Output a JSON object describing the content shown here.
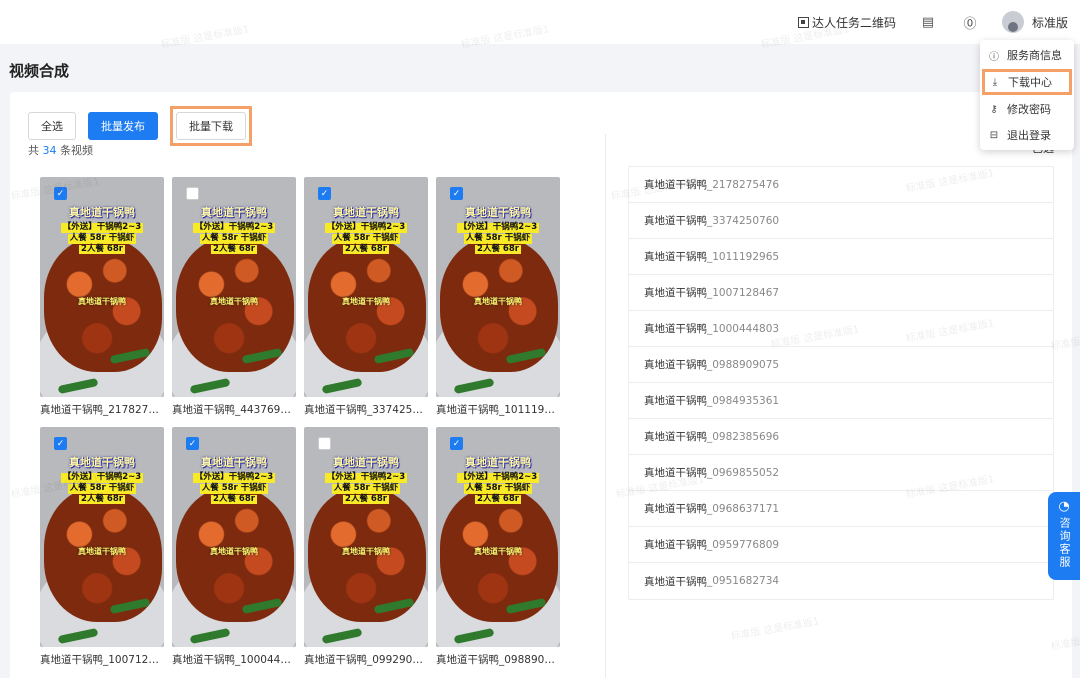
{
  "topbar": {
    "qr_label": "达人任务二维码",
    "message_icon": "message-icon",
    "help_icon": "question-circle-icon",
    "user_label": "标准版"
  },
  "page": {
    "title": "视频合成"
  },
  "toolbar": {
    "select_all": "全选",
    "batch_publish": "批量发布",
    "batch_download": "批量下载"
  },
  "summary": {
    "prefix": "共",
    "count": "34",
    "suffix": "条视频"
  },
  "videos": [
    {
      "name": "真地道干锅鸭_2178275...",
      "checked": true
    },
    {
      "name": "真地道干锅鸭_4437696...",
      "checked": false
    },
    {
      "name": "真地道干锅鸭_3374250...",
      "checked": true
    },
    {
      "name": "真地道干锅鸭_1011192...",
      "checked": true
    },
    {
      "name": "真地道干锅鸭_1007128...",
      "checked": true
    },
    {
      "name": "真地道干锅鸭_1000444...",
      "checked": true
    },
    {
      "name": "真地道干锅鸭_0992903...",
      "checked": false
    },
    {
      "name": "真地道干锅鸭_0988909...",
      "checked": true
    }
  ],
  "thumb_caption": {
    "title": "真地道干锅鸭",
    "line1": "【外送】干锅鸭2~3",
    "line2": "人餐 58r 干锅虾",
    "line3": "2人餐 68r",
    "middle": "真地道干锅鸭"
  },
  "selected_panel": {
    "header": "已选",
    "items": [
      {
        "prefix": "真地道干锅鸭",
        "code": "_2178275476"
      },
      {
        "prefix": "真地道干锅鸭",
        "code": "_3374250760"
      },
      {
        "prefix": "真地道干锅鸭",
        "code": "_1011192965"
      },
      {
        "prefix": "真地道干锅鸭",
        "code": "_1007128467"
      },
      {
        "prefix": "真地道干锅鸭",
        "code": "_1000444803"
      },
      {
        "prefix": "真地道干锅鸭",
        "code": "_0988909075"
      },
      {
        "prefix": "真地道干锅鸭",
        "code": "_0984935361"
      },
      {
        "prefix": "真地道干锅鸭",
        "code": "_0982385696"
      },
      {
        "prefix": "真地道干锅鸭",
        "code": "_0969855052"
      },
      {
        "prefix": "真地道干锅鸭",
        "code": "_0968637171"
      },
      {
        "prefix": "真地道干锅鸭",
        "code": "_0959776809"
      },
      {
        "prefix": "真地道干锅鸭",
        "code": "_0951682734"
      }
    ]
  },
  "user_menu": [
    {
      "label": "服务商信息",
      "icon": "info-circle-icon"
    },
    {
      "label": "下载中心",
      "icon": "download-icon"
    },
    {
      "label": "修改密码",
      "icon": "key-icon"
    },
    {
      "label": "退出登录",
      "icon": "logout-icon"
    }
  ],
  "float_service": {
    "label": "咨询客服",
    "icon": "headset-icon"
  },
  "watermark": "标准版 这是标准版1",
  "colors": {
    "primary": "#1e7cf2",
    "highlight": "#f4a066"
  }
}
